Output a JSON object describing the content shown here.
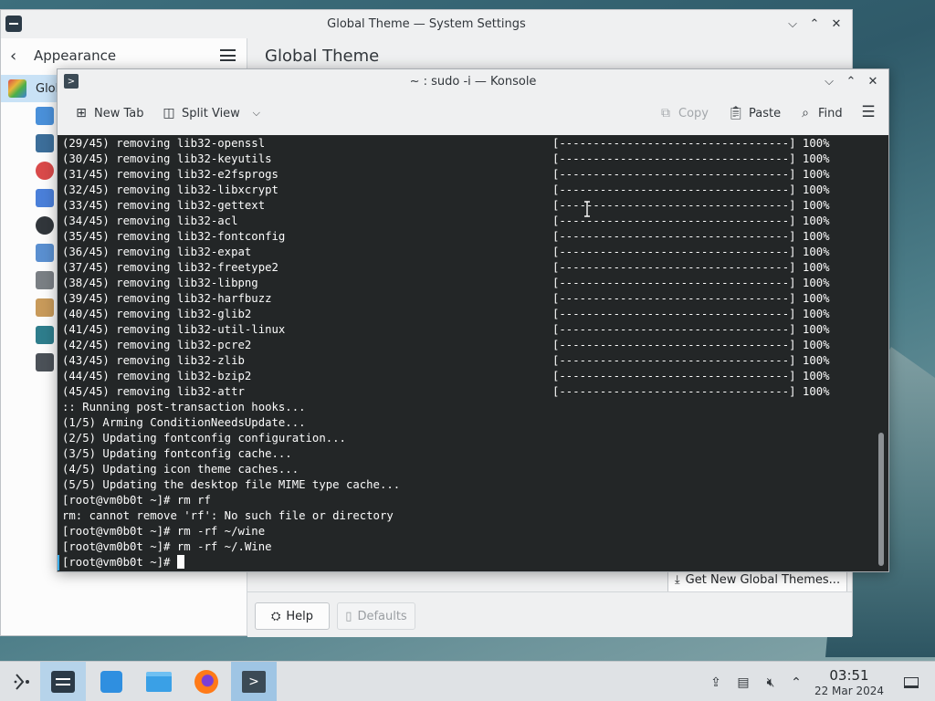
{
  "settings_window": {
    "title": "Global Theme — System Settings",
    "sidebar_back_label": "Appearance",
    "active_item_label": "Glob",
    "page_title": "Global Theme",
    "get_new_label": "Get New Global Themes...",
    "help_label": "Help",
    "defaults_label": "Defaults",
    "sidebar_icon_colors": [
      "#4a90d9",
      "#3c6e9a",
      "#d94a4a",
      "#4a7fd9",
      "#31363b",
      "#5a8fd0",
      "#7a7f84",
      "#c89a5a",
      "#2e7d8c",
      "#4b5158"
    ]
  },
  "konsole": {
    "title": "~ : sudo -i — Konsole",
    "toolbar": {
      "new_tab": "New Tab",
      "split_view": "Split View",
      "copy": "Copy",
      "paste": "Paste",
      "find": "Find"
    },
    "progress_lines": [
      {
        "text": "(29/45) removing lib32-openssl",
        "bar": "[----------------------------------] 100%"
      },
      {
        "text": "(30/45) removing lib32-keyutils",
        "bar": "[----------------------------------] 100%"
      },
      {
        "text": "(31/45) removing lib32-e2fsprogs",
        "bar": "[----------------------------------] 100%"
      },
      {
        "text": "(32/45) removing lib32-libxcrypt",
        "bar": "[----------------------------------] 100%"
      },
      {
        "text": "(33/45) removing lib32-gettext",
        "bar": "[----------------------------------] 100%"
      },
      {
        "text": "(34/45) removing lib32-acl",
        "bar": "[----------------------------------] 100%"
      },
      {
        "text": "(35/45) removing lib32-fontconfig",
        "bar": "[----------------------------------] 100%"
      },
      {
        "text": "(36/45) removing lib32-expat",
        "bar": "[----------------------------------] 100%"
      },
      {
        "text": "(37/45) removing lib32-freetype2",
        "bar": "[----------------------------------] 100%"
      },
      {
        "text": "(38/45) removing lib32-libpng",
        "bar": "[----------------------------------] 100%"
      },
      {
        "text": "(39/45) removing lib32-harfbuzz",
        "bar": "[----------------------------------] 100%"
      },
      {
        "text": "(40/45) removing lib32-glib2",
        "bar": "[----------------------------------] 100%"
      },
      {
        "text": "(41/45) removing lib32-util-linux",
        "bar": "[----------------------------------] 100%"
      },
      {
        "text": "(42/45) removing lib32-pcre2",
        "bar": "[----------------------------------] 100%"
      },
      {
        "text": "(43/45) removing lib32-zlib",
        "bar": "[----------------------------------] 100%"
      },
      {
        "text": "(44/45) removing lib32-bzip2",
        "bar": "[----------------------------------] 100%"
      },
      {
        "text": "(45/45) removing lib32-attr",
        "bar": "[----------------------------------] 100%"
      }
    ],
    "output_lines": [
      ":: Running post-transaction hooks...",
      "(1/5) Arming ConditionNeedsUpdate...",
      "(2/5) Updating fontconfig configuration...",
      "(3/5) Updating fontconfig cache...",
      "(4/5) Updating icon theme caches...",
      "(5/5) Updating the desktop file MIME type cache...",
      "[root@vm0b0t ~]# rm rf",
      "rm: cannot remove 'rf': No such file or directory",
      "[root@vm0b0t ~]# rm -rf ~/wine",
      "[root@vm0b0t ~]# rm -rf ~/.Wine"
    ],
    "prompt": "[root@vm0b0t ~]# "
  },
  "taskbar": {
    "time": "03:51",
    "date": "22 Mar 2024",
    "accent": "#3daee9"
  }
}
